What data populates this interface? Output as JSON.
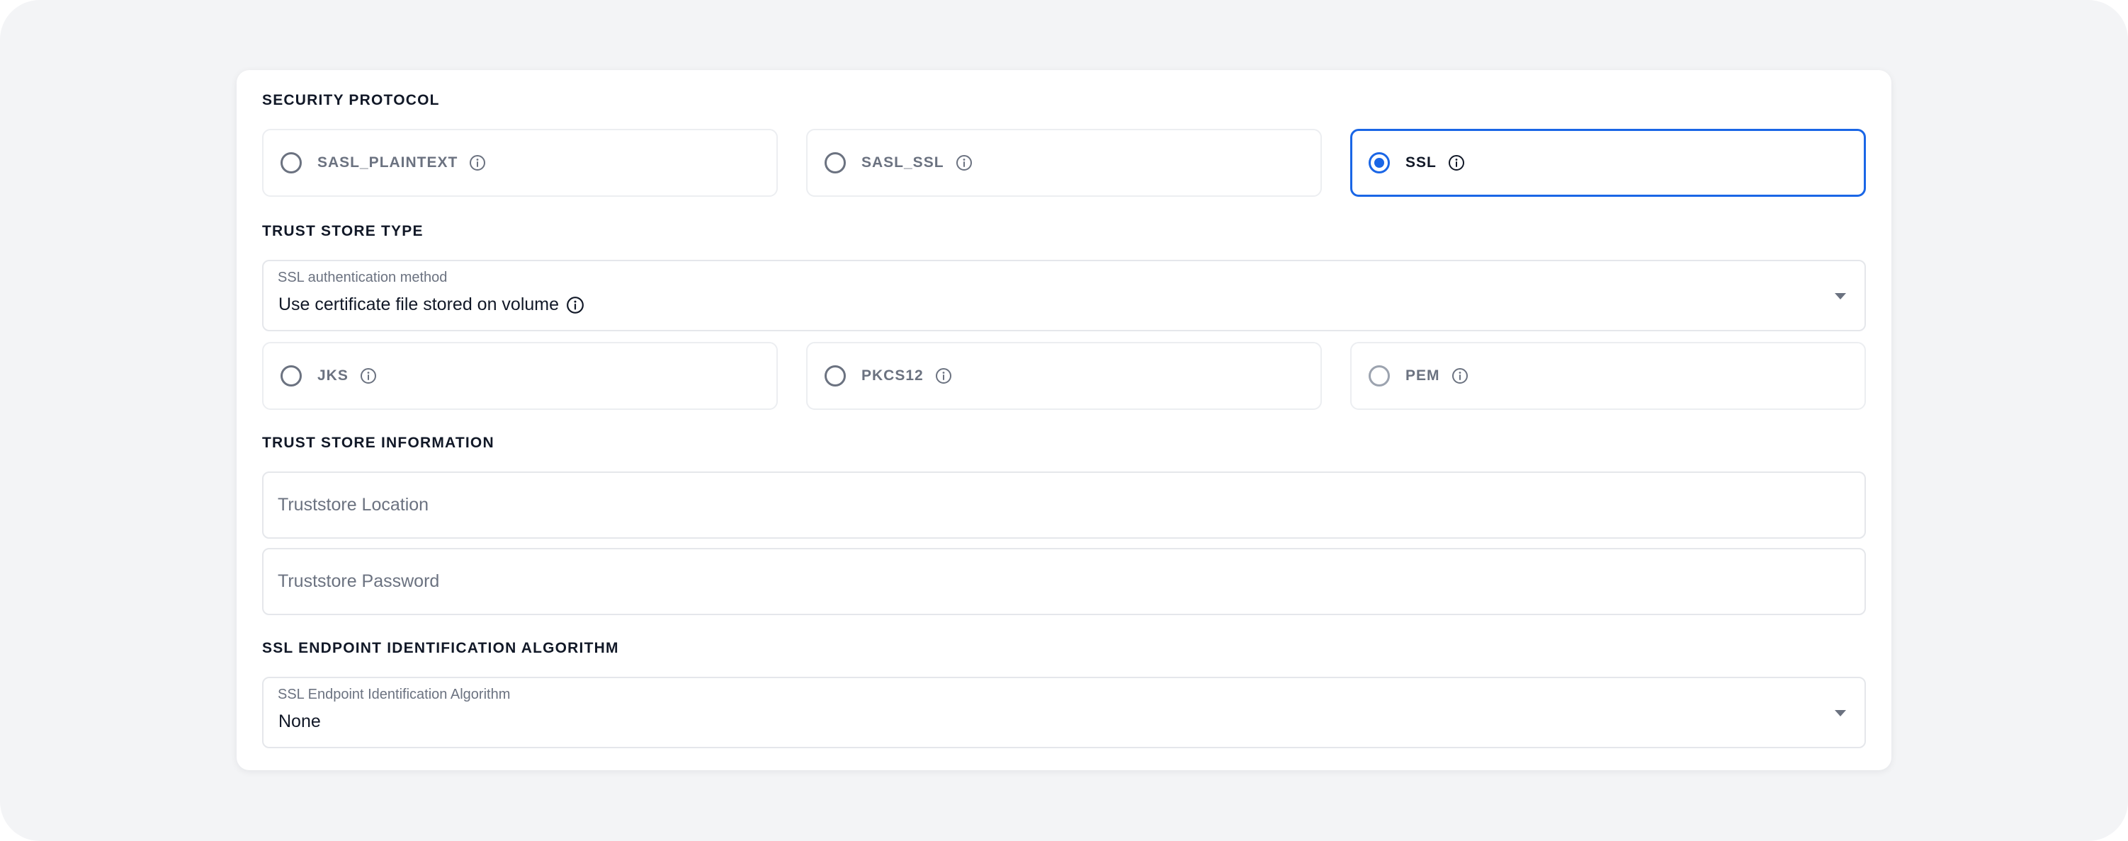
{
  "security_protocol": {
    "title": "SECURITY PROTOCOL",
    "options": [
      {
        "label": "SASL_PLAINTEXT",
        "selected": false
      },
      {
        "label": "SASL_SSL",
        "selected": false
      },
      {
        "label": "SSL",
        "selected": true
      }
    ]
  },
  "trust_store_type": {
    "title": "TRUST STORE TYPE",
    "auth_method": {
      "label": "SSL authentication method",
      "value": "Use certificate file stored on volume"
    },
    "options": [
      {
        "label": "JKS",
        "selected": false
      },
      {
        "label": "PKCS12",
        "selected": false
      },
      {
        "label": "PEM",
        "selected": false
      }
    ]
  },
  "trust_store_information": {
    "title": "TRUST STORE INFORMATION",
    "location": {
      "placeholder": "Truststore Location",
      "value": ""
    },
    "password": {
      "placeholder": "Truststore Password",
      "value": ""
    }
  },
  "ssl_endpoint": {
    "title": "SSL ENDPOINT IDENTIFICATION ALGORITHM",
    "select": {
      "label": "SSL Endpoint Identification Algorithm",
      "value": "None"
    }
  },
  "icons": {
    "info": "info-circle-icon",
    "dropdown": "chevron-down-icon"
  },
  "colors": {
    "accent": "#1a66e6",
    "background": "#f3f4f6",
    "card": "#ffffff",
    "text": "#111827",
    "muted_text": "#6b7280",
    "border": "#e5e7eb"
  }
}
